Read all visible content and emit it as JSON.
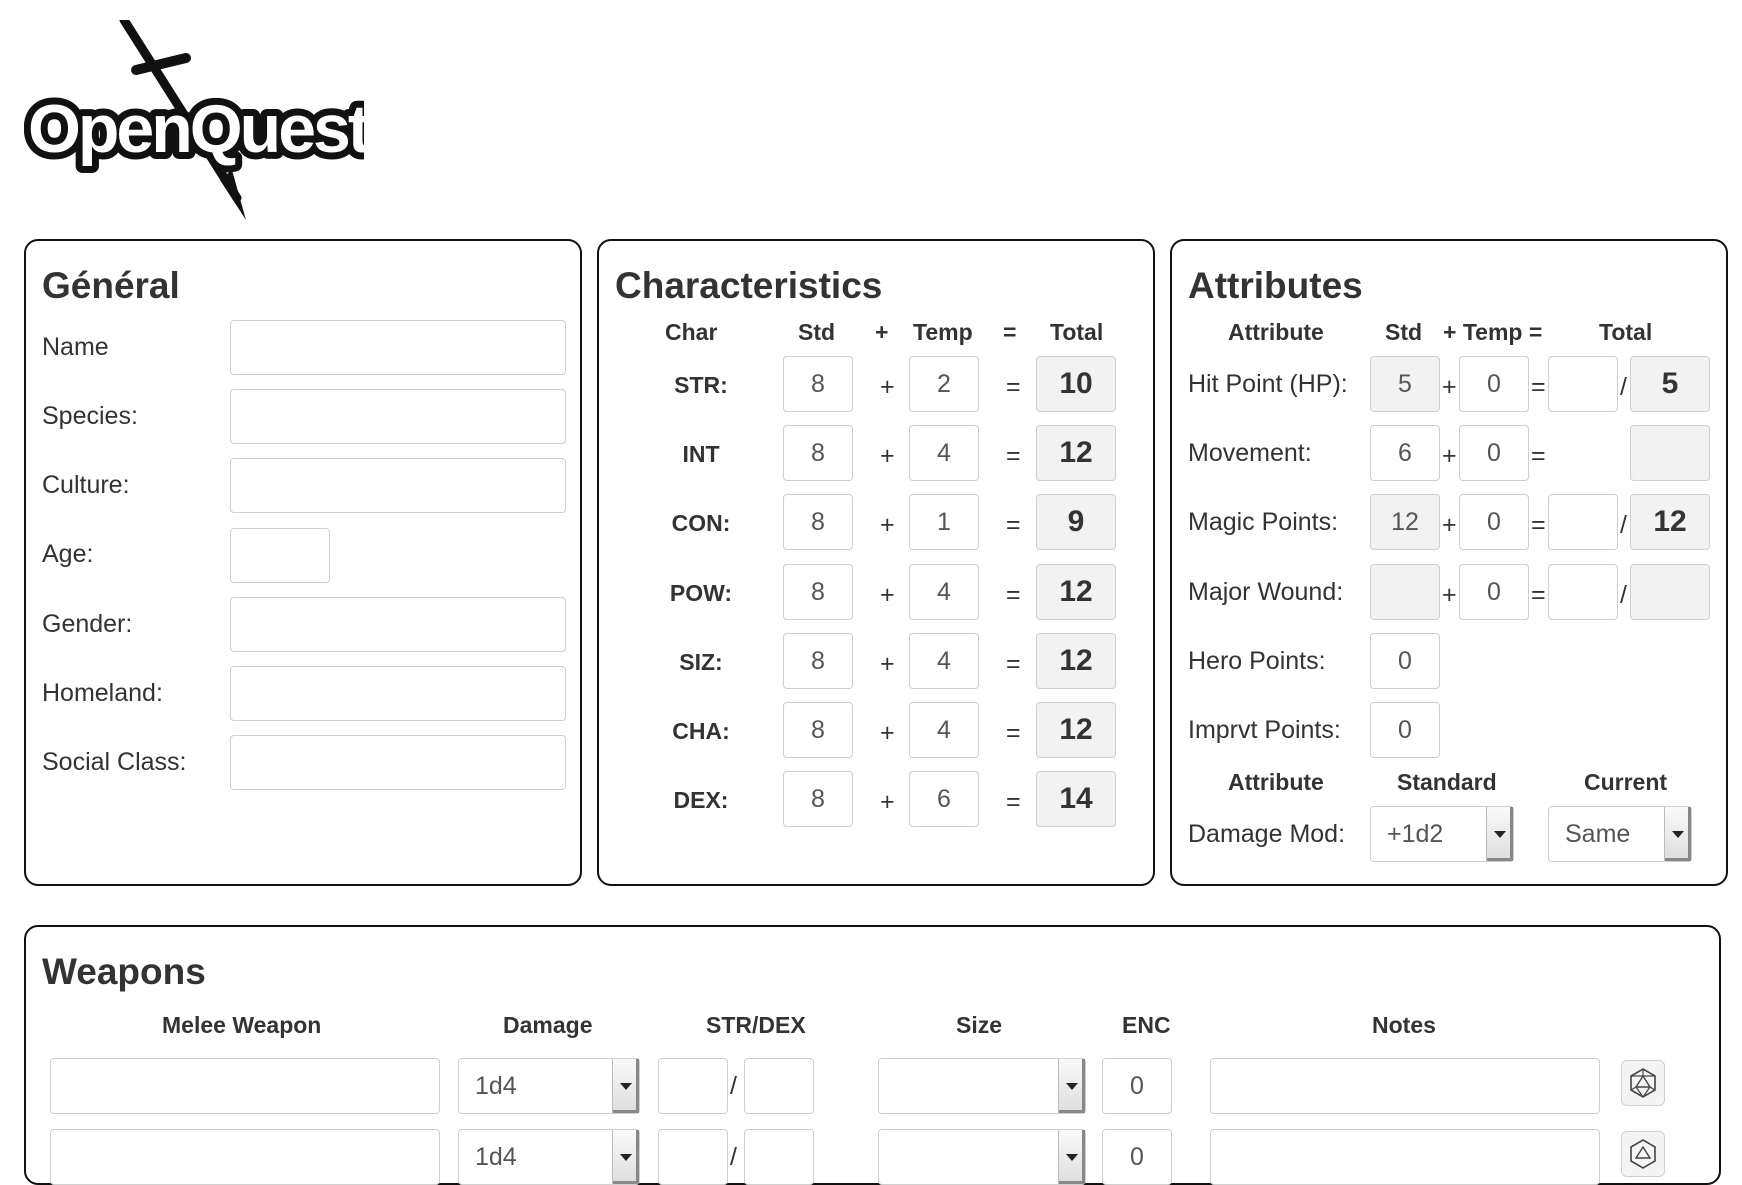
{
  "app": {
    "logo_text": "OpenQuest"
  },
  "general": {
    "title": "Général",
    "fields": [
      {
        "label": "Name",
        "value": ""
      },
      {
        "label": "Species:",
        "value": ""
      },
      {
        "label": "Culture:",
        "value": ""
      },
      {
        "label": "Age:",
        "value": ""
      },
      {
        "label": "Gender:",
        "value": ""
      },
      {
        "label": "Homeland:",
        "value": ""
      },
      {
        "label": "Social Class:",
        "value": ""
      }
    ]
  },
  "characteristics": {
    "title": "Characteristics",
    "headers": {
      "char": "Char",
      "std": "Std",
      "plus": "+",
      "temp": "Temp",
      "eq": "=",
      "total": "Total"
    },
    "rows": [
      {
        "label": "STR:",
        "std": "8",
        "temp": "2",
        "total": "10"
      },
      {
        "label": "INT",
        "std": "8",
        "temp": "4",
        "total": "12"
      },
      {
        "label": "CON:",
        "std": "8",
        "temp": "1",
        "total": "9"
      },
      {
        "label": "POW:",
        "std": "8",
        "temp": "4",
        "total": "12"
      },
      {
        "label": "SIZ:",
        "std": "8",
        "temp": "4",
        "total": "12"
      },
      {
        "label": "CHA:",
        "std": "8",
        "temp": "4",
        "total": "12"
      },
      {
        "label": "DEX:",
        "std": "8",
        "temp": "6",
        "total": "14"
      }
    ]
  },
  "attributes": {
    "title": "Attributes",
    "headers": {
      "attribute": "Attribute",
      "std": "Std",
      "plus_temp_eq": "+ Temp =",
      "total": "Total"
    },
    "rows": [
      {
        "label": "Hit Point (HP):",
        "std": "5",
        "temp": "0",
        "current": "",
        "max": "5"
      },
      {
        "label": "Movement:",
        "std": "6",
        "temp": "0",
        "total": ""
      },
      {
        "label": "Magic Points:",
        "std": "12",
        "temp": "0",
        "current": "",
        "max": "12"
      },
      {
        "label": "Major Wound:",
        "std": "",
        "temp": "0",
        "current": "",
        "max": ""
      }
    ],
    "hero_points": {
      "label": "Hero Points:",
      "value": "0"
    },
    "imprvt_points": {
      "label": "Imprvt Points:",
      "value": "0"
    },
    "headers2": {
      "attribute": "Attribute",
      "standard": "Standard",
      "current": "Current"
    },
    "damage_mod": {
      "label": "Damage Mod:",
      "standard": "+1d2",
      "current": "Same"
    },
    "symbols": {
      "plus": "+",
      "eq": "=",
      "slash": "/"
    }
  },
  "weapons": {
    "title": "Weapons",
    "headers": {
      "melee": "Melee Weapon",
      "damage": "Damage",
      "strdex": "STR/DEX",
      "size": "Size",
      "enc": "ENC",
      "notes": "Notes"
    },
    "rows": [
      {
        "name": "",
        "damage": "1d4",
        "str": "",
        "dex": "",
        "size": "",
        "enc": "0",
        "notes": ""
      },
      {
        "name": "",
        "damage": "1d4",
        "str": "",
        "dex": "",
        "size": "",
        "enc": "0",
        "notes": ""
      }
    ],
    "slash": "/"
  }
}
